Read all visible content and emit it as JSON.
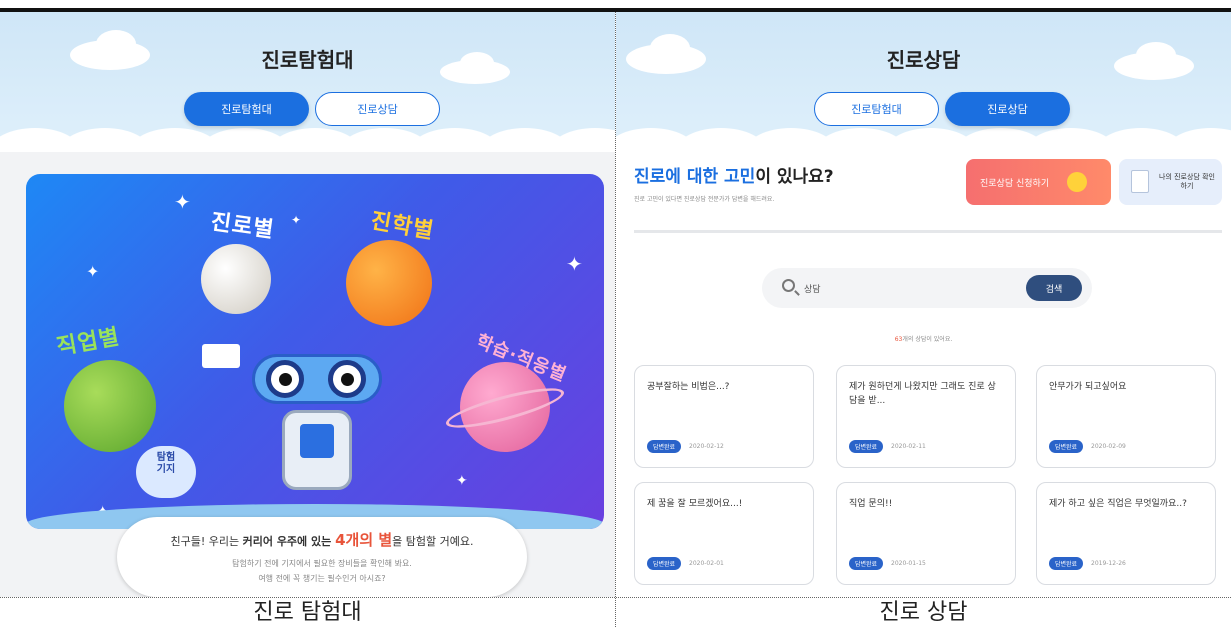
{
  "left_panel": {
    "title": "진로탐험대",
    "tabs": [
      {
        "label": "진로탐험대",
        "active": true
      },
      {
        "label": "진로상담",
        "active": false
      }
    ],
    "planets": [
      {
        "label": "진로별",
        "color": "#e9e6de"
      },
      {
        "label": "진학별",
        "color": "#f58a1f"
      },
      {
        "label": "직업별",
        "color": "#7dbf3b"
      },
      {
        "label": "학습·적응별",
        "color": "#f07fae"
      }
    ],
    "base_label": "탐험\n기지",
    "bubble": {
      "line1_pre": "친구들! 우리는 ",
      "line1_bold": "커리어 우주에 있는 ",
      "line1_highlight": "4개의 별",
      "line1_post": "을 탐험할 거예요.",
      "line2": "탐험하기 전에 기지에서 필요한 장비들을 확인해 봐요.",
      "line3": "여행 전에 꼭 챙기는 필수인거 아시죠?"
    }
  },
  "right_panel": {
    "title": "진로상담",
    "tabs": [
      {
        "label": "진로탐험대",
        "active": false
      },
      {
        "label": "진로상담",
        "active": true
      }
    ],
    "question_blue": "진로에 대한 고민",
    "question_rest": "이 있나요?",
    "question_sub": "진로 고민이 있다면 진로상담 전문가가 답변을 해드려요.",
    "apply_button": "진로상담 신청하기",
    "check_button": "나의 진로상담 확인하기",
    "search": {
      "value": "상담",
      "button": "검색"
    },
    "result_num": "63",
    "result_text": "개의 상담이 있어요.",
    "cards": [
      {
        "title": "공부잘하는 비법은...?",
        "badge": "답변완료",
        "date": "2020-02-12"
      },
      {
        "title": "제가 원하던게 나왔지만 그래도 진로 상담을 받...",
        "badge": "답변완료",
        "date": "2020-02-11"
      },
      {
        "title": "안무가가 되고싶어요",
        "badge": "답변완료",
        "date": "2020-02-09"
      },
      {
        "title": "제 꿈을 잘 모르겠어요...!",
        "badge": "답변완료",
        "date": "2020-02-01"
      },
      {
        "title": "직업 문의!!",
        "badge": "답변완료",
        "date": "2020-01-15"
      },
      {
        "title": "제가 하고 싶은 직업은 무엇일까요..?",
        "badge": "답변완료",
        "date": "2019-12-26"
      }
    ]
  },
  "captions": {
    "left": "진로 탐험대",
    "right": "진로 상담"
  },
  "colors": {
    "accent": "#1b6fe0",
    "apply": "#f56f6f",
    "badge": "#2a63c9",
    "search_button": "#2f4e7e"
  }
}
